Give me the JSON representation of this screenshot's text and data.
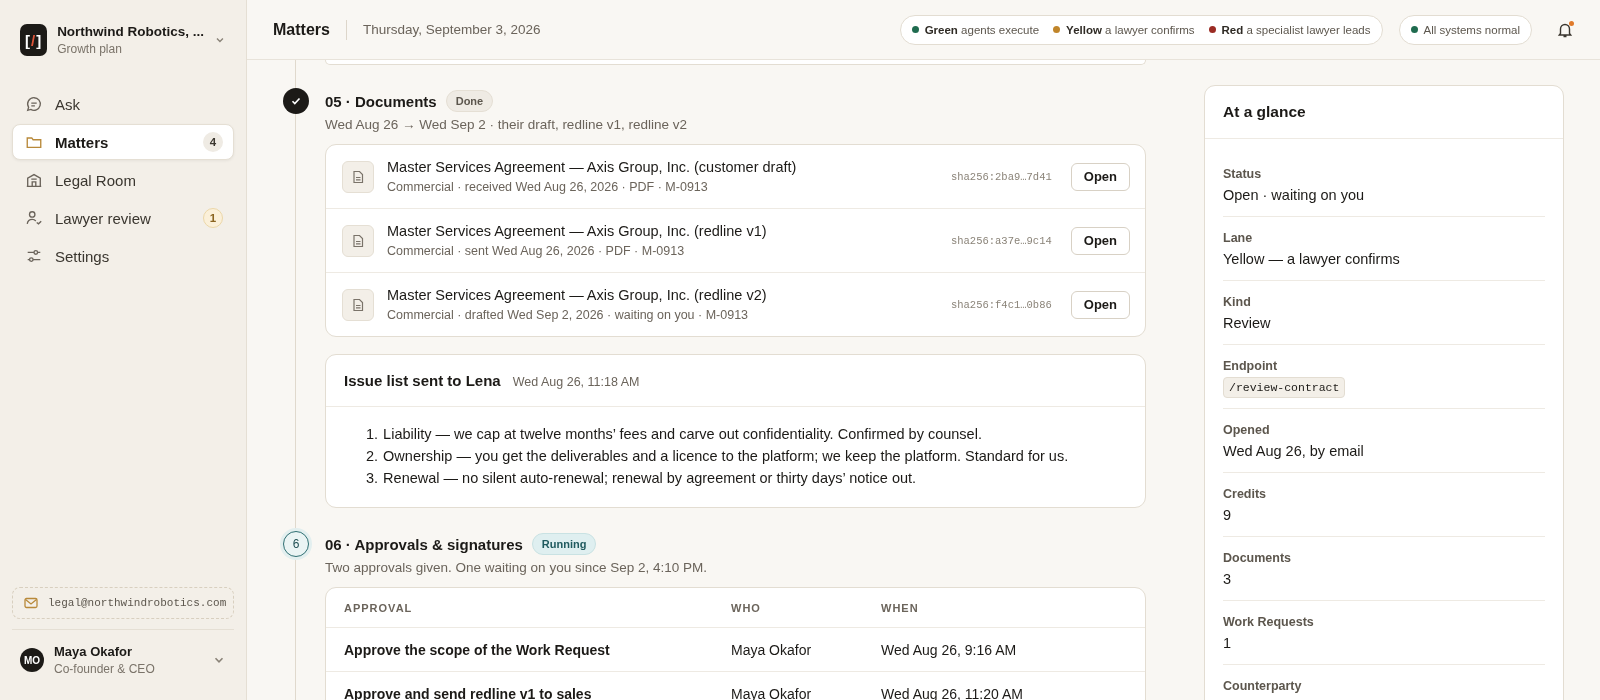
{
  "sidebar": {
    "org": {
      "logo": {
        "left": "[",
        "mark": "/",
        "right": "]"
      },
      "name": "Northwind Robotics, ...",
      "plan": "Growth plan"
    },
    "nav": [
      {
        "kind": "ask",
        "label": "Ask",
        "selected": false
      },
      {
        "kind": "folder",
        "label": "Matters",
        "selected": true,
        "badge": "4",
        "badge_highlighted": false
      },
      {
        "kind": "building",
        "label": "Legal Room",
        "selected": false
      },
      {
        "kind": "person",
        "label": "Lawyer review",
        "selected": false,
        "badge": "1",
        "badge_highlighted": true
      },
      {
        "kind": "sliders",
        "label": "Settings",
        "selected": false
      }
    ],
    "email": "legal@northwindrobotics.com",
    "user": {
      "initials": "MO",
      "name": "Maya Okafor",
      "role": "Co-founder & CEO"
    }
  },
  "header": {
    "title": "Matters",
    "date": "Thursday, September 3, 2026",
    "legend": [
      {
        "color": "#1f6b4f",
        "text": "**Green** agents execute"
      },
      {
        "color": "#c0852a",
        "text": "**Yellow** a lawyer confirms"
      },
      {
        "color": "#9b2c24",
        "text": "**Red** a specialist lawyer leads"
      }
    ],
    "system_status": {
      "color": "#1f6b4f",
      "text": "All systems normal"
    },
    "notifications": {
      "unread": true
    }
  },
  "steps": [
    {
      "done": true,
      "title": "05 · Documents",
      "badge": "Done",
      "subtitle": "Wed Aug 26 → Wed Sep 2 · their draft, redline v1, redline v2",
      "documents": [
        {
          "title": "Master Services Agreement — Axis Group, Inc. (customer draft)",
          "meta": "Commercial · received Wed Aug 26, 2026 · PDF · M-0913",
          "hash": "sha256:2ba9…7d41",
          "action": "Open"
        },
        {
          "title": "Master Services Agreement — Axis Group, Inc. (redline v1)",
          "meta": "Commercial · sent Wed Aug 26, 2026 · PDF · M-0913",
          "hash": "sha256:a37e…9c14",
          "action": "Open"
        },
        {
          "title": "Master Services Agreement — Axis Group, Inc. (redline v2)",
          "meta": "Commercial · drafted Wed Sep 2, 2026 · waiting on you · M-0913",
          "hash": "sha256:f4c1…0b86",
          "action": "Open"
        }
      ],
      "note": {
        "title": "Issue list sent to Lena",
        "time": "Wed Aug 26, 11:18 AM",
        "items": [
          {
            "number": "1.",
            "text": "Liability — we cap at twelve months’ fees and carve out confidentiality. Confirmed by counsel."
          },
          {
            "number": "2.",
            "text": "Ownership — you get the deliverables and a licence to the platform; we keep the platform. Standard for us."
          },
          {
            "number": "3.",
            "text": "Renewal — no silent auto-renewal; renewal by agreement or thirty days’ notice out."
          }
        ]
      }
    },
    {
      "done": false,
      "number": "6",
      "title": "06 · Approvals & signatures",
      "badge": "Running",
      "subtitle": "Two approvals given. One waiting on you since Sep 2, 4:10 PM.",
      "table": {
        "columns": [
          "APPROVAL",
          "WHO",
          "WHEN"
        ],
        "rows": [
          [
            "Approve the scope of the Work Request",
            "Maya Okafor",
            "Wed Aug 26, 9:16 AM"
          ],
          [
            "Approve and send redline v1 to sales",
            "Maya Okafor",
            "Wed Aug 26, 11:20 AM"
          ]
        ]
      }
    }
  ],
  "glance": {
    "title": "At a glance",
    "fields": [
      {
        "label": "Status",
        "value": "Open · waiting on you",
        "kind": "text"
      },
      {
        "label": "Lane",
        "value": "Yellow — a lawyer confirms",
        "kind": "text"
      },
      {
        "label": "Kind",
        "value": "Review",
        "kind": "text"
      },
      {
        "label": "Endpoint",
        "value": "/review-contract",
        "kind": "code"
      },
      {
        "label": "Opened",
        "value": "Wed Aug 26, by email",
        "kind": "text"
      },
      {
        "label": "Credits",
        "value": "9",
        "kind": "text"
      },
      {
        "label": "Documents",
        "value": "3",
        "kind": "text"
      },
      {
        "label": "Work Requests",
        "value": "1",
        "kind": "text"
      },
      {
        "label": "Counterparty"
      }
    ]
  }
}
